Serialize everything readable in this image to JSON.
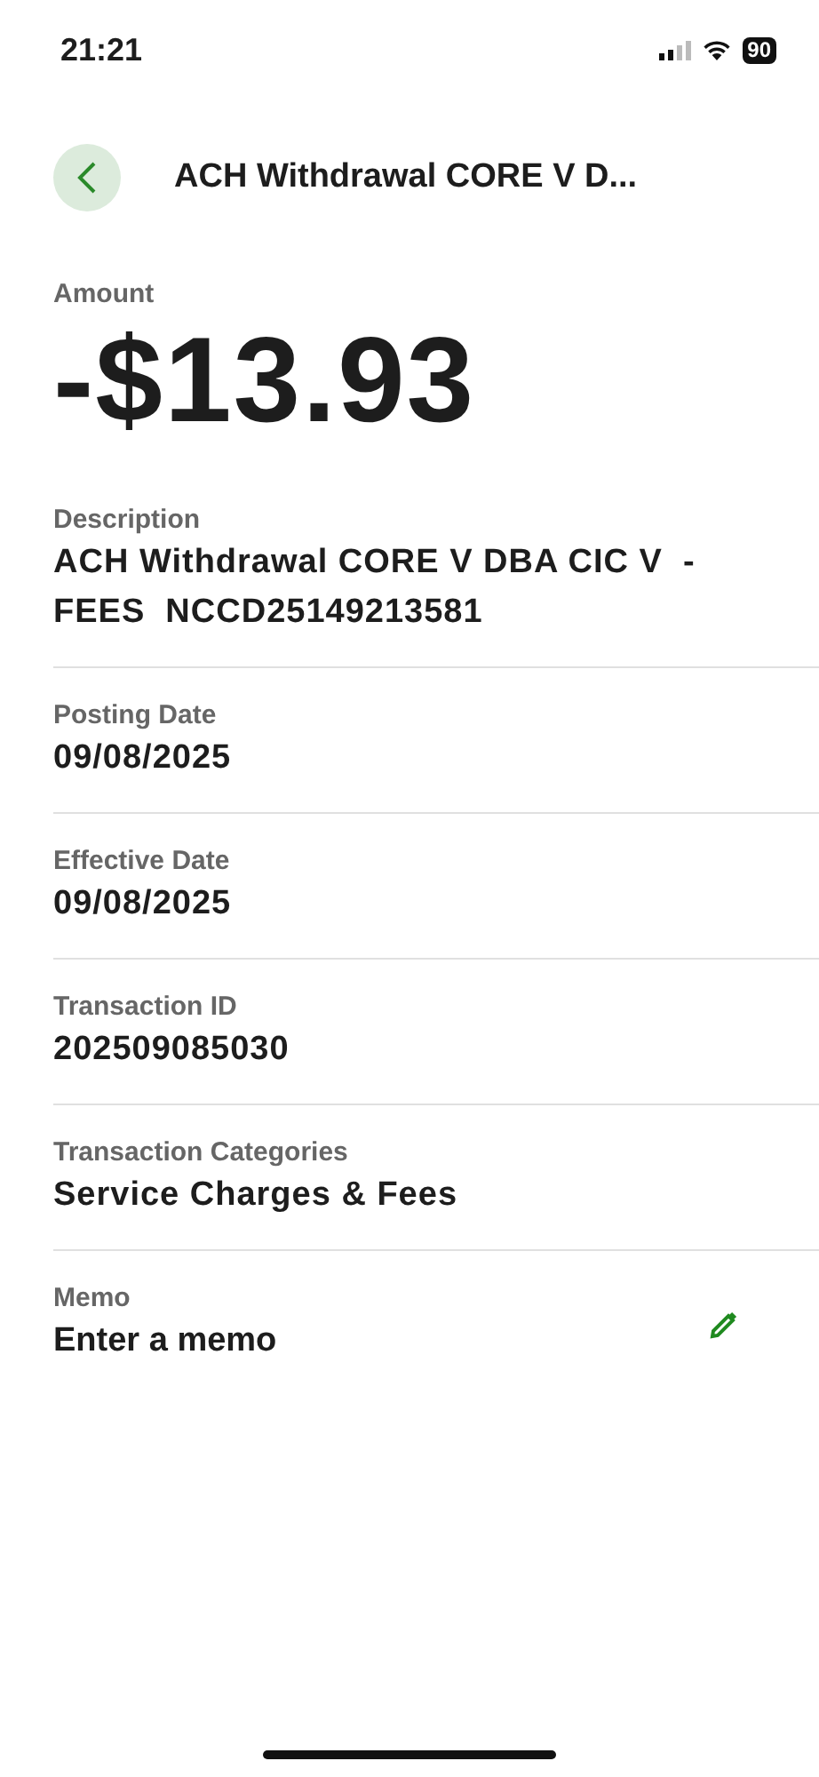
{
  "status_bar": {
    "time": "21:21",
    "battery": "90"
  },
  "header": {
    "title": "ACH Withdrawal CORE V D..."
  },
  "amount": {
    "label": "Amount",
    "value": "-$13.93"
  },
  "fields": [
    {
      "kind": "text",
      "label": "Description",
      "value": "ACH Withdrawal CORE V DBA CIC V  - FEES  NCCD25149213581"
    },
    {
      "kind": "text",
      "label": "Posting Date",
      "value": "09/08/2025"
    },
    {
      "kind": "text",
      "label": "Effective Date",
      "value": "09/08/2025"
    },
    {
      "kind": "text",
      "label": "Transaction ID",
      "value": "202509085030"
    },
    {
      "kind": "text",
      "label": "Transaction Categories",
      "value": "Service Charges & Fees"
    },
    {
      "kind": "memo",
      "label": "Memo",
      "placeholder": "Enter a memo"
    }
  ]
}
